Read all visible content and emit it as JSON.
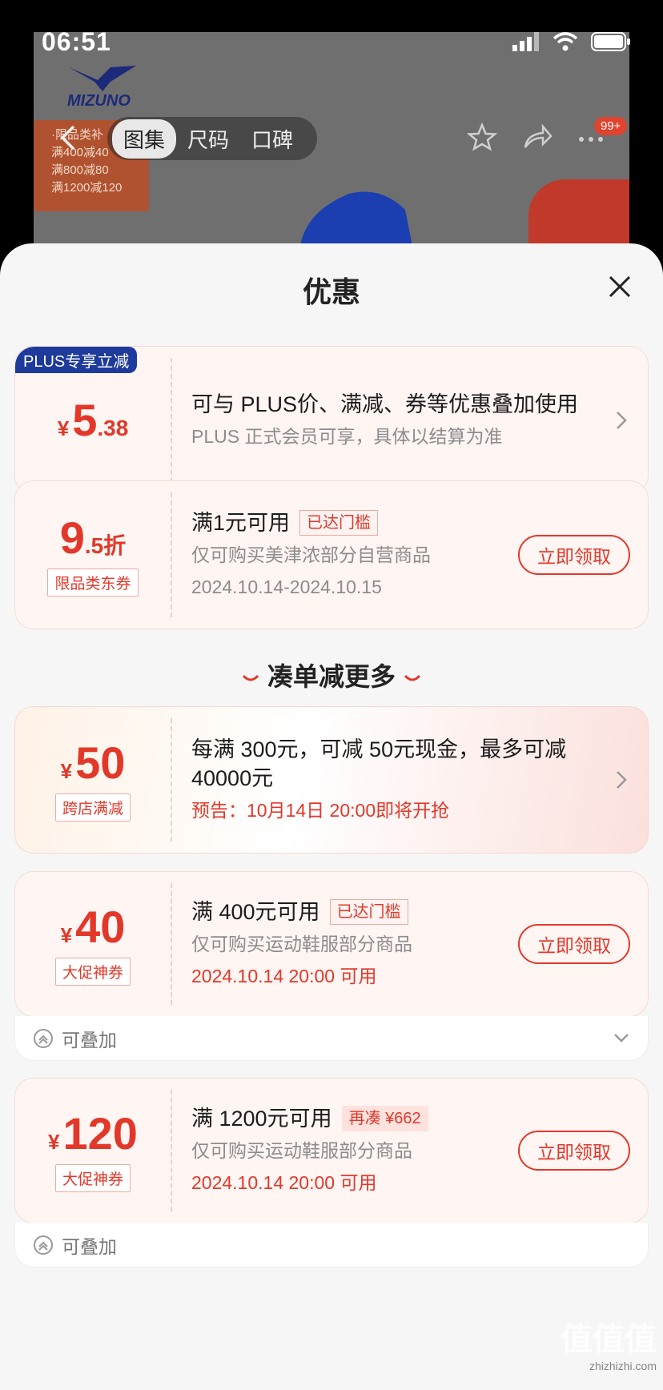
{
  "status_bar": {
    "time": "06:51"
  },
  "background": {
    "tabs": [
      "图集",
      "尺码",
      "口碑"
    ],
    "active_tab": "图集",
    "promo_lines": [
      "·限品类补",
      "满400减40",
      "满800减80",
      "满1200减120"
    ],
    "badge": "99+",
    "brand": "MIZUNO"
  },
  "sheet": {
    "title": "优惠",
    "section_header": "凑单减更多"
  },
  "offers": [
    {
      "badge": "PLUS专享立减",
      "currency": "¥",
      "amount": "5",
      "decimal": ".38",
      "title": "可与 PLUS价、满减、券等优惠叠加使用",
      "subtitle": "PLUS 正式会员可享，具体以结算为准"
    },
    {
      "amount": "9",
      "decimal": ".5折",
      "tag": "限品类东券",
      "title": "满1元可用",
      "status": "已达门槛",
      "subtitle": "仅可购买美津浓部分自营商品",
      "date": "2024.10.14-2024.10.15",
      "action": "立即领取"
    }
  ],
  "more_offers": [
    {
      "currency": "¥",
      "amount": "50",
      "tag": "跨店满减",
      "title": "每满 300元，可减 50元现金，最多可减 40000元",
      "note": "预告：10月14日 20:00即将开抢"
    },
    {
      "currency": "¥",
      "amount": "40",
      "tag": "大促神券",
      "title": "满 400元可用",
      "status": "已达门槛",
      "subtitle": "仅可购买运动鞋服部分商品",
      "date": "2024.10.14 20:00 可用",
      "action": "立即领取",
      "stack_label": "可叠加"
    },
    {
      "currency": "¥",
      "amount": "120",
      "tag": "大促神券",
      "title": "满 1200元可用",
      "status": "再凑 ¥662",
      "subtitle": "仅可购买运动鞋服部分商品",
      "date": "2024.10.14 20:00 可用",
      "action": "立即领取",
      "stack_label": "可叠加"
    }
  ],
  "watermark": {
    "main": "值值值",
    "sub": "zhizhizhi.com"
  },
  "colors": {
    "accent": "#e2382a",
    "plus_badge": "#1e3b9c"
  }
}
